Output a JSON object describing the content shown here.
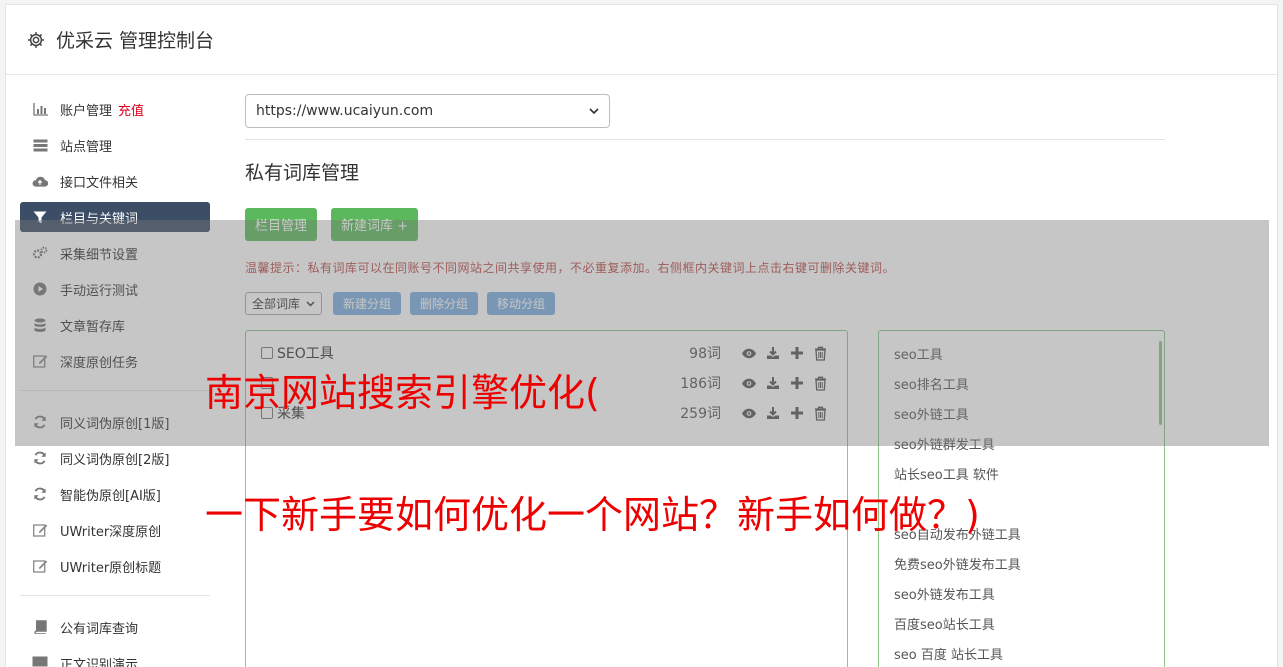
{
  "header": {
    "title": "优采云 管理控制台"
  },
  "sidebar": {
    "items": [
      {
        "label": "账户管理",
        "badge": "充值",
        "icon": "bar-chart-icon"
      },
      {
        "label": "站点管理",
        "icon": "server-icon"
      },
      {
        "label": "接口文件相关",
        "icon": "cloud-upload-icon"
      },
      {
        "label": "栏目与关键词",
        "icon": "filter-icon"
      },
      {
        "label": "采集细节设置",
        "icon": "gears-icon"
      },
      {
        "label": "手动运行测试",
        "icon": "play-icon"
      },
      {
        "label": "文章暂存库",
        "icon": "database-icon"
      },
      {
        "label": "深度原创任务",
        "icon": "edit-icon"
      }
    ],
    "items2": [
      {
        "label": "同义词伪原创[1版]",
        "icon": "refresh-icon"
      },
      {
        "label": "同义词伪原创[2版]",
        "icon": "refresh-icon"
      },
      {
        "label": "智能伪原创[AI版]",
        "icon": "refresh-icon"
      },
      {
        "label": "UWriter深度原创",
        "icon": "edit-icon"
      },
      {
        "label": "UWriter原创标题",
        "icon": "edit-icon"
      }
    ],
    "items3": [
      {
        "label": "公有词库查询",
        "icon": "book-icon"
      },
      {
        "label": "正文识别演示",
        "icon": "monitor-icon"
      }
    ]
  },
  "main": {
    "site_select": "https://www.ucaiyun.com",
    "page_title": "私有词库管理",
    "btn_column": "栏目管理",
    "btn_new_lib": "新建词库 +",
    "tip": "温馨提示：私有词库可以在同账号不同网站之间共享使用，不必重复添加。右侧框内关键词上点击右键可删除关键词。",
    "filter_select": "全部词库",
    "btn_new_group": "新建分组",
    "btn_delete_group": "删除分组",
    "btn_move_group": "移动分组",
    "groups": [
      {
        "name": "SEO工具",
        "count": "98词"
      },
      {
        "name": "",
        "count": "186词"
      },
      {
        "name": "采集",
        "count": "259词"
      }
    ],
    "keywords": [
      "seo工具",
      "seo排名工具",
      "seo外链工具",
      "seo外链群发工具",
      "站长seo工具 软件",
      "",
      "seo自动发布外链工具",
      "免费seo外链发布工具",
      "seo外链发布工具",
      "百度seo站长工具",
      "seo 百度 站长工具"
    ]
  },
  "overlay": {
    "line1": "南京网站搜索引擎优化(",
    "line2": "一下新手要如何优化一个网站？新手如何做？)"
  },
  "colors": {
    "active_nav": "#3c4d66",
    "green": "#5cb85c",
    "blue": "#7aaee0",
    "headline": "#ee0000",
    "tip": "#b94a48"
  }
}
